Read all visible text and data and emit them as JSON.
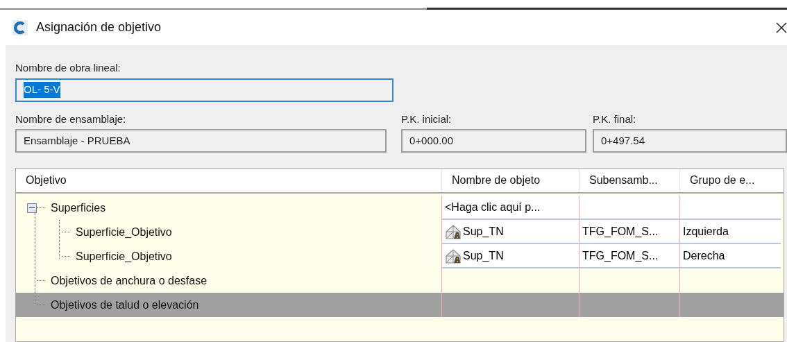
{
  "window": {
    "title": "Asignación de objetivo"
  },
  "alignment_field": {
    "label": "Nombre de obra lineal:",
    "value": "OL- 5-V",
    "focused": true
  },
  "assembly_field": {
    "label": "Nombre de ensamblaje:",
    "value": "Ensamblaje - PRUEBA"
  },
  "start_station_field": {
    "label": "P.K. inicial:",
    "value": "0+000.00"
  },
  "end_station_field": {
    "label": "P.K. final:",
    "value": "0+497.54"
  },
  "table": {
    "columns": [
      "Objetivo",
      "Nombre de objeto",
      "Subensamb...",
      "Grupo de e..."
    ],
    "rows": [
      {
        "label": "Superficies",
        "kind": "surface-group",
        "expanded": true,
        "selected": false,
        "cells": [
          "<Haga clic aquí p...",
          "",
          ""
        ],
        "children": [
          {
            "label": "Superficie_Objetivo",
            "kind": "surface",
            "selected": false,
            "cells": [
              "Sup_TN",
              "TFG_FOM_S...",
              "Izquierda"
            ]
          },
          {
            "label": "Superficie_Objetivo",
            "kind": "surface",
            "selected": false,
            "cells": [
              "Sup_TN",
              "TFG_FOM_S...",
              "Derecha"
            ]
          }
        ]
      },
      {
        "label": "Objetivos de anchura o desfase",
        "kind": "category",
        "selected": false
      },
      {
        "label": "Objetivos de talud o elevación",
        "kind": "category",
        "selected": true
      }
    ]
  }
}
